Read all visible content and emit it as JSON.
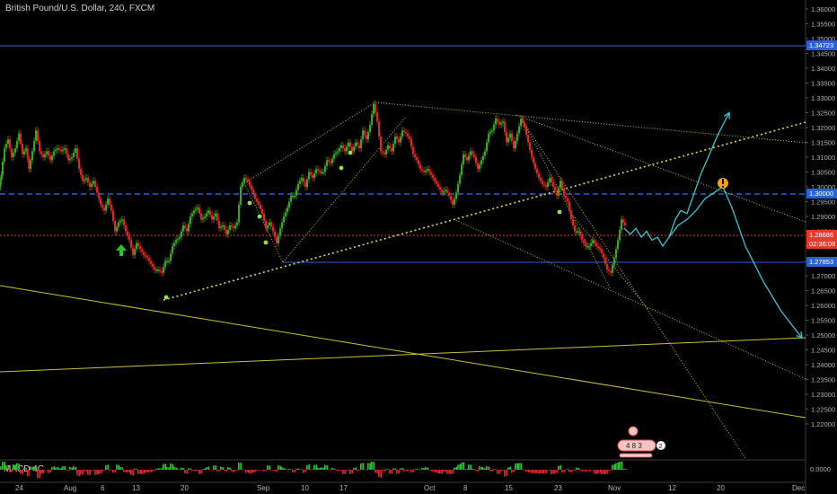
{
  "header": {
    "title": "British Pound/U.S. Dollar, 240, FXCM"
  },
  "indicator": {
    "name": "MACD 4C",
    "zero_label": "0.0000"
  },
  "colors": {
    "background": "#000000",
    "up_candle": "#3fa126",
    "down_candle": "#d62a2a",
    "trendline": "#e6d84a",
    "forecast": "#3ec3d4",
    "level_blue": "#2c61d6",
    "last_price": "#e8392e"
  },
  "tags": {
    "level_top": "1.34723",
    "level_mid": "1.30000",
    "last_price": "1.28686",
    "countdown": "02:36:08",
    "level_low": "1.27853"
  },
  "badge": {
    "digits": "4 8 3",
    "count": "2"
  },
  "chart_data": {
    "type": "candlestick",
    "symbol": "GBPUSD",
    "timeframe": "240",
    "y_ticks": [
      "1.36000",
      "1.35500",
      "1.35000",
      "1.34500",
      "1.34000",
      "1.33500",
      "1.33000",
      "1.32500",
      "1.32000",
      "1.31500",
      "1.31000",
      "1.30500",
      "1.30000",
      "1.29500",
      "1.29000",
      "1.28500",
      "1.28000",
      "1.27500",
      "1.27000",
      "1.26500",
      "1.26000",
      "1.25500",
      "1.25000",
      "1.24500",
      "1.24000",
      "1.23500",
      "1.23000",
      "1.22500",
      "1.22000"
    ],
    "x_ticks": [
      "24",
      "Aug",
      "6",
      "13",
      "20",
      "Sep",
      "10",
      "17",
      "Oct",
      "8",
      "15",
      "23",
      "Nov",
      "12",
      "20",
      "Dec"
    ],
    "horizontal_levels": [
      1.34723,
      1.3,
      1.27853
    ],
    "last_price": 1.28686,
    "price_path": [
      [
        0,
        1.3
      ],
      [
        2,
        1.304
      ],
      [
        6,
        1.313
      ],
      [
        10,
        1.316
      ],
      [
        14,
        1.31
      ],
      [
        18,
        1.313
      ],
      [
        22,
        1.318
      ],
      [
        26,
        1.311
      ],
      [
        30,
        1.313
      ],
      [
        33,
        1.306
      ],
      [
        37,
        1.312
      ],
      [
        41,
        1.319
      ],
      [
        45,
        1.312
      ],
      [
        49,
        1.31
      ],
      [
        53,
        1.312
      ],
      [
        57,
        1.309
      ],
      [
        61,
        1.312
      ],
      [
        65,
        1.313
      ],
      [
        69,
        1.312
      ],
      [
        73,
        1.313
      ],
      [
        77,
        1.309
      ],
      [
        81,
        1.31
      ],
      [
        85,
        1.313
      ],
      [
        89,
        1.306
      ],
      [
        93,
        1.302
      ],
      [
        97,
        1.303
      ],
      [
        101,
        1.3
      ],
      [
        105,
        1.302
      ],
      [
        109,
        1.298
      ],
      [
        113,
        1.294
      ],
      [
        117,
        1.292
      ],
      [
        121,
        1.296
      ],
      [
        125,
        1.292
      ],
      [
        129,
        1.285
      ],
      [
        133,
        1.288
      ],
      [
        137,
        1.289
      ],
      [
        141,
        1.285
      ],
      [
        145,
        1.282
      ],
      [
        149,
        1.277
      ],
      [
        153,
        1.281
      ],
      [
        157,
        1.279
      ],
      [
        161,
        1.277
      ],
      [
        165,
        1.276
      ],
      [
        169,
        1.274
      ],
      [
        173,
        1.272
      ],
      [
        177,
        1.272
      ],
      [
        181,
        1.271
      ],
      [
        185,
        1.275
      ],
      [
        189,
        1.275
      ],
      [
        193,
        1.28
      ],
      [
        197,
        1.282
      ],
      [
        201,
        1.283
      ],
      [
        205,
        1.287
      ],
      [
        209,
        1.285
      ],
      [
        213,
        1.29
      ],
      [
        217,
        1.292
      ],
      [
        221,
        1.293
      ],
      [
        225,
        1.289
      ],
      [
        229,
        1.29
      ],
      [
        233,
        1.292
      ],
      [
        237,
        1.289
      ],
      [
        241,
        1.291
      ],
      [
        245,
        1.286
      ],
      [
        249,
        1.287
      ],
      [
        253,
        1.284
      ],
      [
        257,
        1.287
      ],
      [
        261,
        1.286
      ],
      [
        265,
        1.288
      ],
      [
        269,
        1.3
      ],
      [
        273,
        1.303
      ],
      [
        277,
        1.302
      ],
      [
        281,
        1.299
      ],
      [
        285,
        1.296
      ],
      [
        289,
        1.294
      ],
      [
        293,
        1.291
      ],
      [
        297,
        1.286
      ],
      [
        301,
        1.288
      ],
      [
        305,
        1.285
      ],
      [
        309,
        1.281
      ],
      [
        313,
        1.286
      ],
      [
        317,
        1.29
      ],
      [
        321,
        1.293
      ],
      [
        325,
        1.297
      ],
      [
        329,
        1.297
      ],
      [
        333,
        1.301
      ],
      [
        337,
        1.303
      ],
      [
        341,
        1.3
      ],
      [
        345,
        1.305
      ],
      [
        349,
        1.303
      ],
      [
        353,
        1.306
      ],
      [
        357,
        1.305
      ],
      [
        361,
        1.305
      ],
      [
        365,
        1.309
      ],
      [
        369,
        1.308
      ],
      [
        373,
        1.311
      ],
      [
        377,
        1.312
      ],
      [
        381,
        1.314
      ],
      [
        385,
        1.312
      ],
      [
        389,
        1.315
      ],
      [
        393,
        1.312
      ],
      [
        397,
        1.315
      ],
      [
        401,
        1.313
      ],
      [
        405,
        1.319
      ],
      [
        409,
        1.316
      ],
      [
        413,
        1.321
      ],
      [
        417,
        1.328
      ],
      [
        421,
        1.322
      ],
      [
        425,
        1.312
      ],
      [
        429,
        1.311
      ],
      [
        433,
        1.314
      ],
      [
        437,
        1.312
      ],
      [
        441,
        1.317
      ],
      [
        445,
        1.315
      ],
      [
        449,
        1.319
      ],
      [
        453,
        1.318
      ],
      [
        457,
        1.316
      ],
      [
        461,
        1.311
      ],
      [
        465,
        1.309
      ],
      [
        469,
        1.306
      ],
      [
        473,
        1.305
      ],
      [
        477,
        1.306
      ],
      [
        481,
        1.304
      ],
      [
        485,
        1.302
      ],
      [
        489,
        1.3
      ],
      [
        493,
        1.298
      ],
      [
        497,
        1.299
      ],
      [
        501,
        1.297
      ],
      [
        505,
        1.294
      ],
      [
        509,
        1.298
      ],
      [
        513,
        1.304
      ],
      [
        517,
        1.311
      ],
      [
        521,
        1.309
      ],
      [
        525,
        1.312
      ],
      [
        529,
        1.31
      ],
      [
        533,
        1.306
      ],
      [
        537,
        1.309
      ],
      [
        541,
        1.312
      ],
      [
        545,
        1.318
      ],
      [
        549,
        1.319
      ],
      [
        553,
        1.323
      ],
      [
        557,
        1.321
      ],
      [
        561,
        1.322
      ],
      [
        565,
        1.315
      ],
      [
        569,
        1.318
      ],
      [
        573,
        1.313
      ],
      [
        577,
        1.318
      ],
      [
        581,
        1.323
      ],
      [
        585,
        1.32
      ],
      [
        589,
        1.315
      ],
      [
        593,
        1.31
      ],
      [
        597,
        1.306
      ],
      [
        601,
        1.303
      ],
      [
        605,
        1.301
      ],
      [
        609,
        1.3
      ],
      [
        613,
        1.303
      ],
      [
        617,
        1.3
      ],
      [
        621,
        1.297
      ],
      [
        625,
        1.302
      ],
      [
        629,
        1.297
      ],
      [
        633,
        1.295
      ],
      [
        637,
        1.289
      ],
      [
        641,
        1.285
      ],
      [
        645,
        1.285
      ],
      [
        649,
        1.282
      ],
      [
        653,
        1.28
      ],
      [
        657,
        1.28
      ],
      [
        661,
        1.282
      ],
      [
        665,
        1.28
      ],
      [
        669,
        1.279
      ],
      [
        673,
        1.276
      ],
      [
        677,
        1.272
      ],
      [
        681,
        1.271
      ],
      [
        685,
        1.276
      ],
      [
        689,
        1.282
      ],
      [
        693,
        1.289
      ],
      [
        697,
        1.287
      ]
    ],
    "forecast_paths": [
      [
        [
          695,
          1.286
        ],
        [
          702,
          1.284
        ],
        [
          708,
          1.286
        ],
        [
          714,
          1.283
        ],
        [
          720,
          1.285
        ],
        [
          726,
          1.282
        ],
        [
          732,
          1.283
        ],
        [
          738,
          1.28
        ],
        [
          745,
          1.283
        ],
        [
          752,
          1.289
        ],
        [
          758,
          1.292
        ],
        [
          765,
          1.291
        ],
        [
          772,
          1.297
        ],
        [
          780,
          1.304
        ],
        [
          790,
          1.311
        ],
        [
          800,
          1.318
        ],
        [
          812,
          1.325
        ]
      ],
      [
        [
          745,
          1.283
        ],
        [
          755,
          1.287
        ],
        [
          765,
          1.289
        ],
        [
          775,
          1.292
        ],
        [
          785,
          1.296
        ],
        [
          795,
          1.298
        ],
        [
          805,
          1.3
        ],
        [
          815,
          1.293
        ],
        [
          830,
          1.28
        ],
        [
          850,
          1.268
        ],
        [
          870,
          1.258
        ],
        [
          893,
          1.249
        ]
      ]
    ],
    "grid": false,
    "legend": "none"
  }
}
